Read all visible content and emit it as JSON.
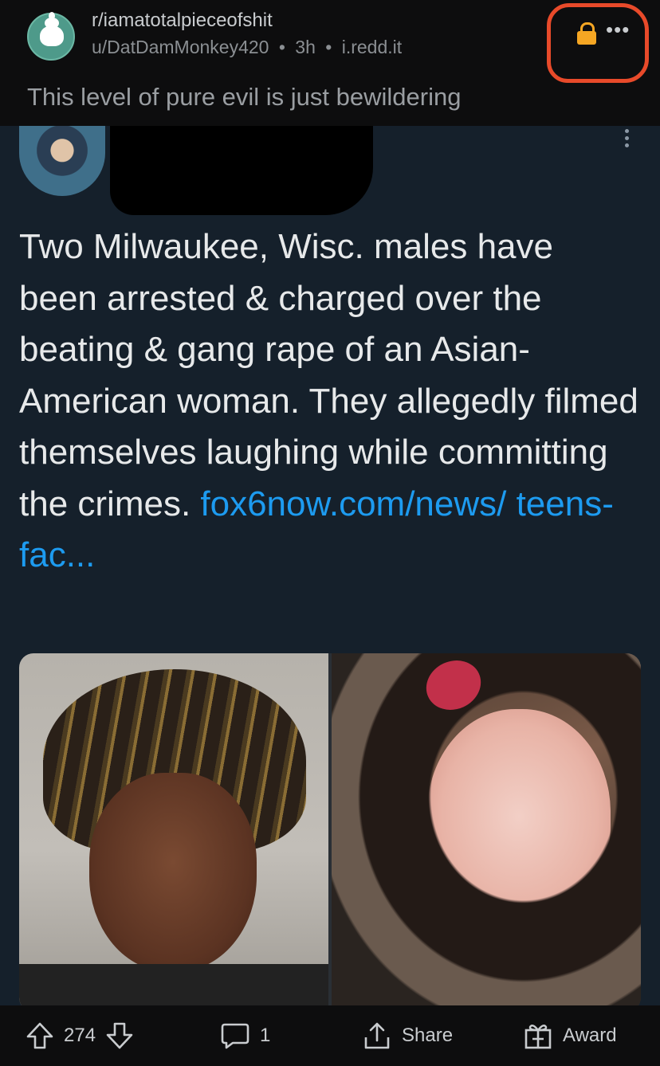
{
  "header": {
    "subreddit": "r/iamatotalpieceofshit",
    "author": "u/DatDamMonkey420",
    "sep": "•",
    "time": "3h",
    "domain": "i.redd.it",
    "more_icon": "more-dots-icon",
    "lock_icon": "lock-icon",
    "lock_color": "#f5a623",
    "annotation_color": "#e84a2a"
  },
  "post": {
    "title": "This level of pure evil is just bewildering"
  },
  "tweet": {
    "text": "Two Milwaukee, Wisc. males have been arrested & charged over the beating & gang rape of an Asian-American woman. They allegedly filmed themselves laughing while committing the crimes. ",
    "link": "fox6now.com/news/ teens-fac...",
    "link_color": "#1d9bf0"
  },
  "actions": {
    "upvote_icon": "arrow-up-icon",
    "score": "274",
    "downvote_icon": "arrow-down-icon",
    "comments_icon": "comment-icon",
    "comments": "1",
    "share_icon": "share-icon",
    "share": "Share",
    "award_icon": "gift-icon",
    "award": "Award"
  }
}
